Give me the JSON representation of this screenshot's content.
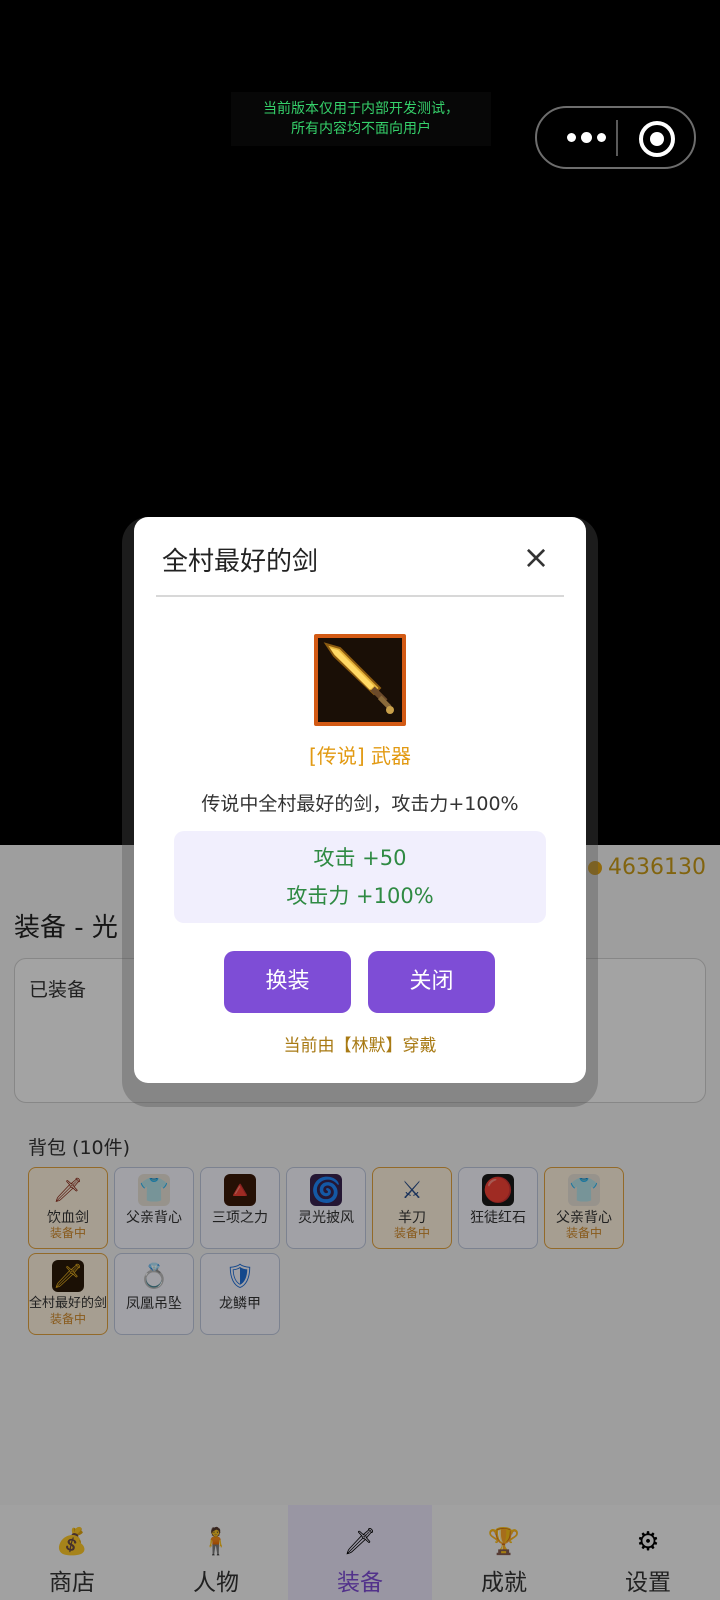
{
  "notice": {
    "line1": "当前版本仅用于内部开发测试，",
    "line2": "所有内容均不面向用户"
  },
  "header": {
    "coins": "4636130",
    "page_title": "装备 - 光"
  },
  "equipped_section": {
    "label": "已装备"
  },
  "bag": {
    "title": "背包 (10件)",
    "items": [
      {
        "name": "饮血剑",
        "status": "装备中",
        "icon": "blood-sword-icon"
      },
      {
        "name": "父亲背心",
        "status": "",
        "icon": "vest-icon"
      },
      {
        "name": "三项之力",
        "status": "",
        "icon": "trinity-force-icon"
      },
      {
        "name": "灵光披风",
        "status": "",
        "icon": "cloak-icon"
      },
      {
        "name": "羊刀",
        "status": "装备中",
        "icon": "scimitar-icon"
      },
      {
        "name": "狂徒红石",
        "status": "",
        "icon": "red-stone-icon"
      },
      {
        "name": "父亲背心",
        "status": "装备中",
        "icon": "vest-icon"
      },
      {
        "name": "全村最好的剑",
        "status": "装备中",
        "icon": "golden-sword-icon"
      },
      {
        "name": "凤凰吊坠",
        "status": "",
        "icon": "pendant-icon"
      },
      {
        "name": "龙鳞甲",
        "status": "",
        "icon": "shield-icon"
      }
    ]
  },
  "tabs": [
    {
      "label": "商店",
      "icon": "money-bag-icon"
    },
    {
      "label": "人物",
      "icon": "person-icon"
    },
    {
      "label": "装备",
      "icon": "sword-icon"
    },
    {
      "label": "成就",
      "icon": "trophy-icon"
    },
    {
      "label": "设置",
      "icon": "gear-icon"
    }
  ],
  "modal": {
    "title": "全村最好的剑",
    "rarity": "[传说] 武器",
    "description": "传说中全村最好的剑，攻击力+100%",
    "stats": [
      "攻击 +50",
      "攻击力 +100%"
    ],
    "swap_label": "换装",
    "close_label": "关闭",
    "owner_note": "当前由【林默】穿戴"
  },
  "colors": {
    "accent": "#7e4dd6",
    "legend": "#e29a13",
    "stat_text": "#2f8a43",
    "notice_text": "#35d06a"
  }
}
